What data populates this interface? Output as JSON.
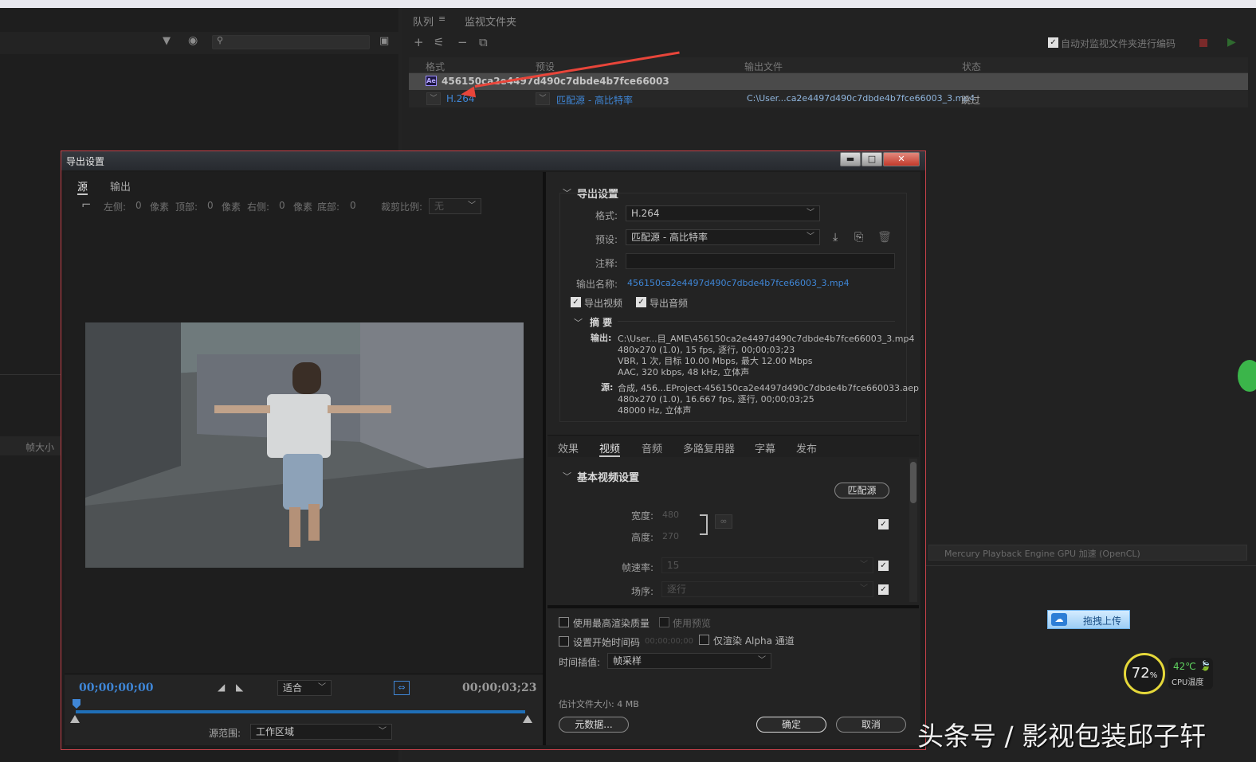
{
  "colors": {
    "accent_blue": "#3f86d6",
    "arrow_red": "#e8453a",
    "dialog_border": "#c8424a"
  },
  "left": {
    "col_frame_size": "帧大小"
  },
  "queue": {
    "tabs": [
      "队列",
      "监视文件夹"
    ],
    "auto_encode_label": "自动对监视文件夹进行编码",
    "columns": {
      "format": "格式",
      "preset": "预设",
      "output": "输出文件",
      "status": "状态"
    },
    "item_name": "456150ca2e4497d490c7dbde4b7fce66003",
    "item_badge": "Ae",
    "sub_format": "H.264",
    "sub_preset": "匹配源 - 高比特率",
    "sub_output": "C:\\User...ca2e4497d490c7dbde4b7fce66003_3.mp4",
    "sub_status": "跳过",
    "renderer": "Mercury Playback Engine GPU 加速 (OpenCL)"
  },
  "dialog": {
    "title": "导出设置",
    "source_tabs": [
      "源",
      "输出"
    ],
    "crop": {
      "left": "左侧:",
      "top": "顶部:",
      "right": "右侧:",
      "bottom": "底部:",
      "zero": "0",
      "unit": "像素",
      "ratio_label": "裁剪比例:",
      "ratio_value": "无"
    },
    "timecode_start": "00;00;00;00",
    "timecode_end": "00;00;03;23",
    "fit": "适合",
    "source_range_label": "源范围:",
    "source_range_value": "工作区域"
  },
  "export_settings": {
    "section_title": "导出设置",
    "format_label": "格式:",
    "format_value": "H.264",
    "preset_label": "预设:",
    "preset_value": "匹配源 - 高比特率",
    "comment_label": "注释:",
    "output_name_label": "输出名称:",
    "output_name_value": "456150ca2e4497d490c7dbde4b7fce66003_3.mp4",
    "export_video": "导出视频",
    "export_audio": "导出音频",
    "summary_title": "摘 要",
    "output_label": "输出:",
    "output_lines": [
      "C:\\User...目_AME\\456150ca2e4497d490c7dbde4b7fce66003_3.mp4",
      "480x270 (1.0), 15 fps, 逐行, 00;00;03;23",
      "VBR, 1 次, 目标 10.00 Mbps, 最大 12.00 Mbps",
      "AAC, 320 kbps, 48 kHz, 立体声"
    ],
    "source_label": "源:",
    "source_lines": [
      "合成, 456...EProject-456150ca2e4497d490c7dbde4b7fce660033.aep",
      "480x270 (1.0), 16.667 fps, 逐行, 00;00;03;25",
      "48000 Hz, 立体声"
    ]
  },
  "subtabs": [
    "效果",
    "视频",
    "音频",
    "多路复用器",
    "字幕",
    "发布"
  ],
  "video": {
    "section_title": "基本视频设置",
    "match_source": "匹配源",
    "width_label": "宽度:",
    "width_value": "480",
    "height_label": "高度:",
    "height_value": "270",
    "fps_label": "帧速率:",
    "fps_value": "15",
    "field_label": "场序:",
    "field_value": "逐行"
  },
  "options": {
    "max_quality": "使用最高渲染质量",
    "use_preview": "使用预览",
    "set_start_tc": "设置开始时间码",
    "start_tc_value": "00;00;00;00",
    "alpha_only": "仅渲染 Alpha 通道",
    "interp_label": "时间插值:",
    "interp_value": "帧采样",
    "file_size": "估计文件大小: 4 MB",
    "metadata_btn": "元数据...",
    "ok_btn": "确定",
    "cancel_btn": "取消"
  },
  "overlay": {
    "watermark": "头条号 / 影视包装邱子轩",
    "baidu_label": "拖拽上传",
    "cpu_pct": "72",
    "cpu_pct_unit": "%",
    "cpu_temp": "42℃",
    "cpu_temp_label": "CPU温度"
  }
}
